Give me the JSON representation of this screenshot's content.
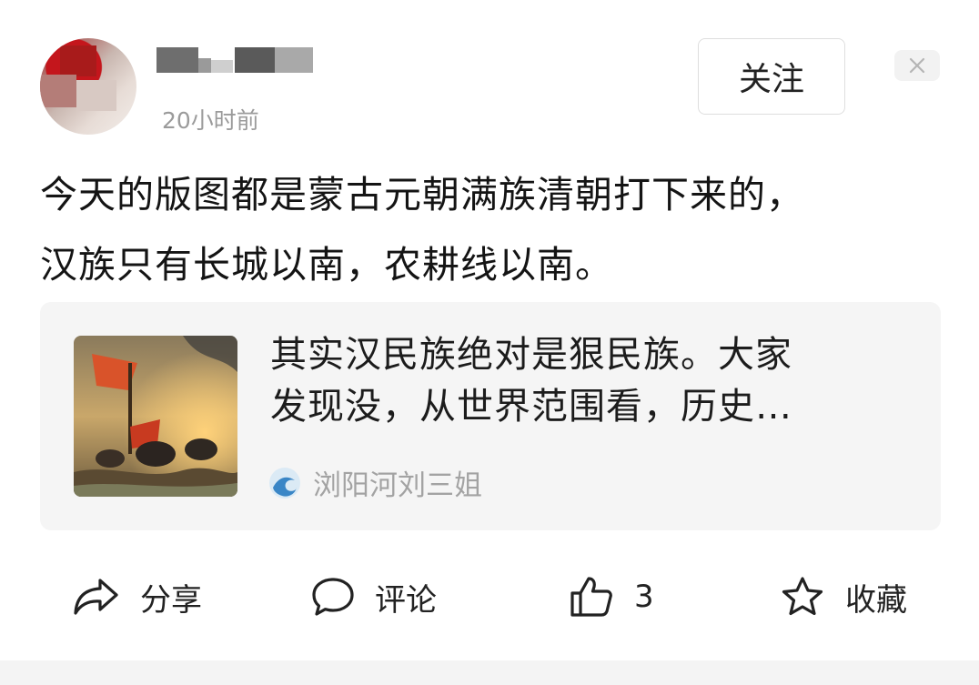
{
  "post": {
    "username": "",
    "time": "20小时前",
    "follow_label": "关注",
    "close_label": "×",
    "text_line1": "今天的版图都是蒙古元朝满族清朝打下来的，",
    "text_line2": "汉族只有长城以南，农耕线以南。"
  },
  "card": {
    "title_line1": "其实汉民族绝对是狠民族。大家",
    "title_line2": "发现没，从世界范围看，历史…",
    "source_name": "浏阳河刘三姐"
  },
  "actions": {
    "share_label": "分享",
    "comment_label": "评论",
    "like_count": "3",
    "collect_label": "收藏"
  },
  "icons": {
    "share": "share-icon",
    "comment": "comment-icon",
    "like": "thumbs-up-icon",
    "collect": "star-icon",
    "close": "close-icon"
  },
  "colors": {
    "time_gray": "#9b9b9b",
    "card_bg": "#f5f5f5",
    "source_gray": "#a3a3a3"
  }
}
